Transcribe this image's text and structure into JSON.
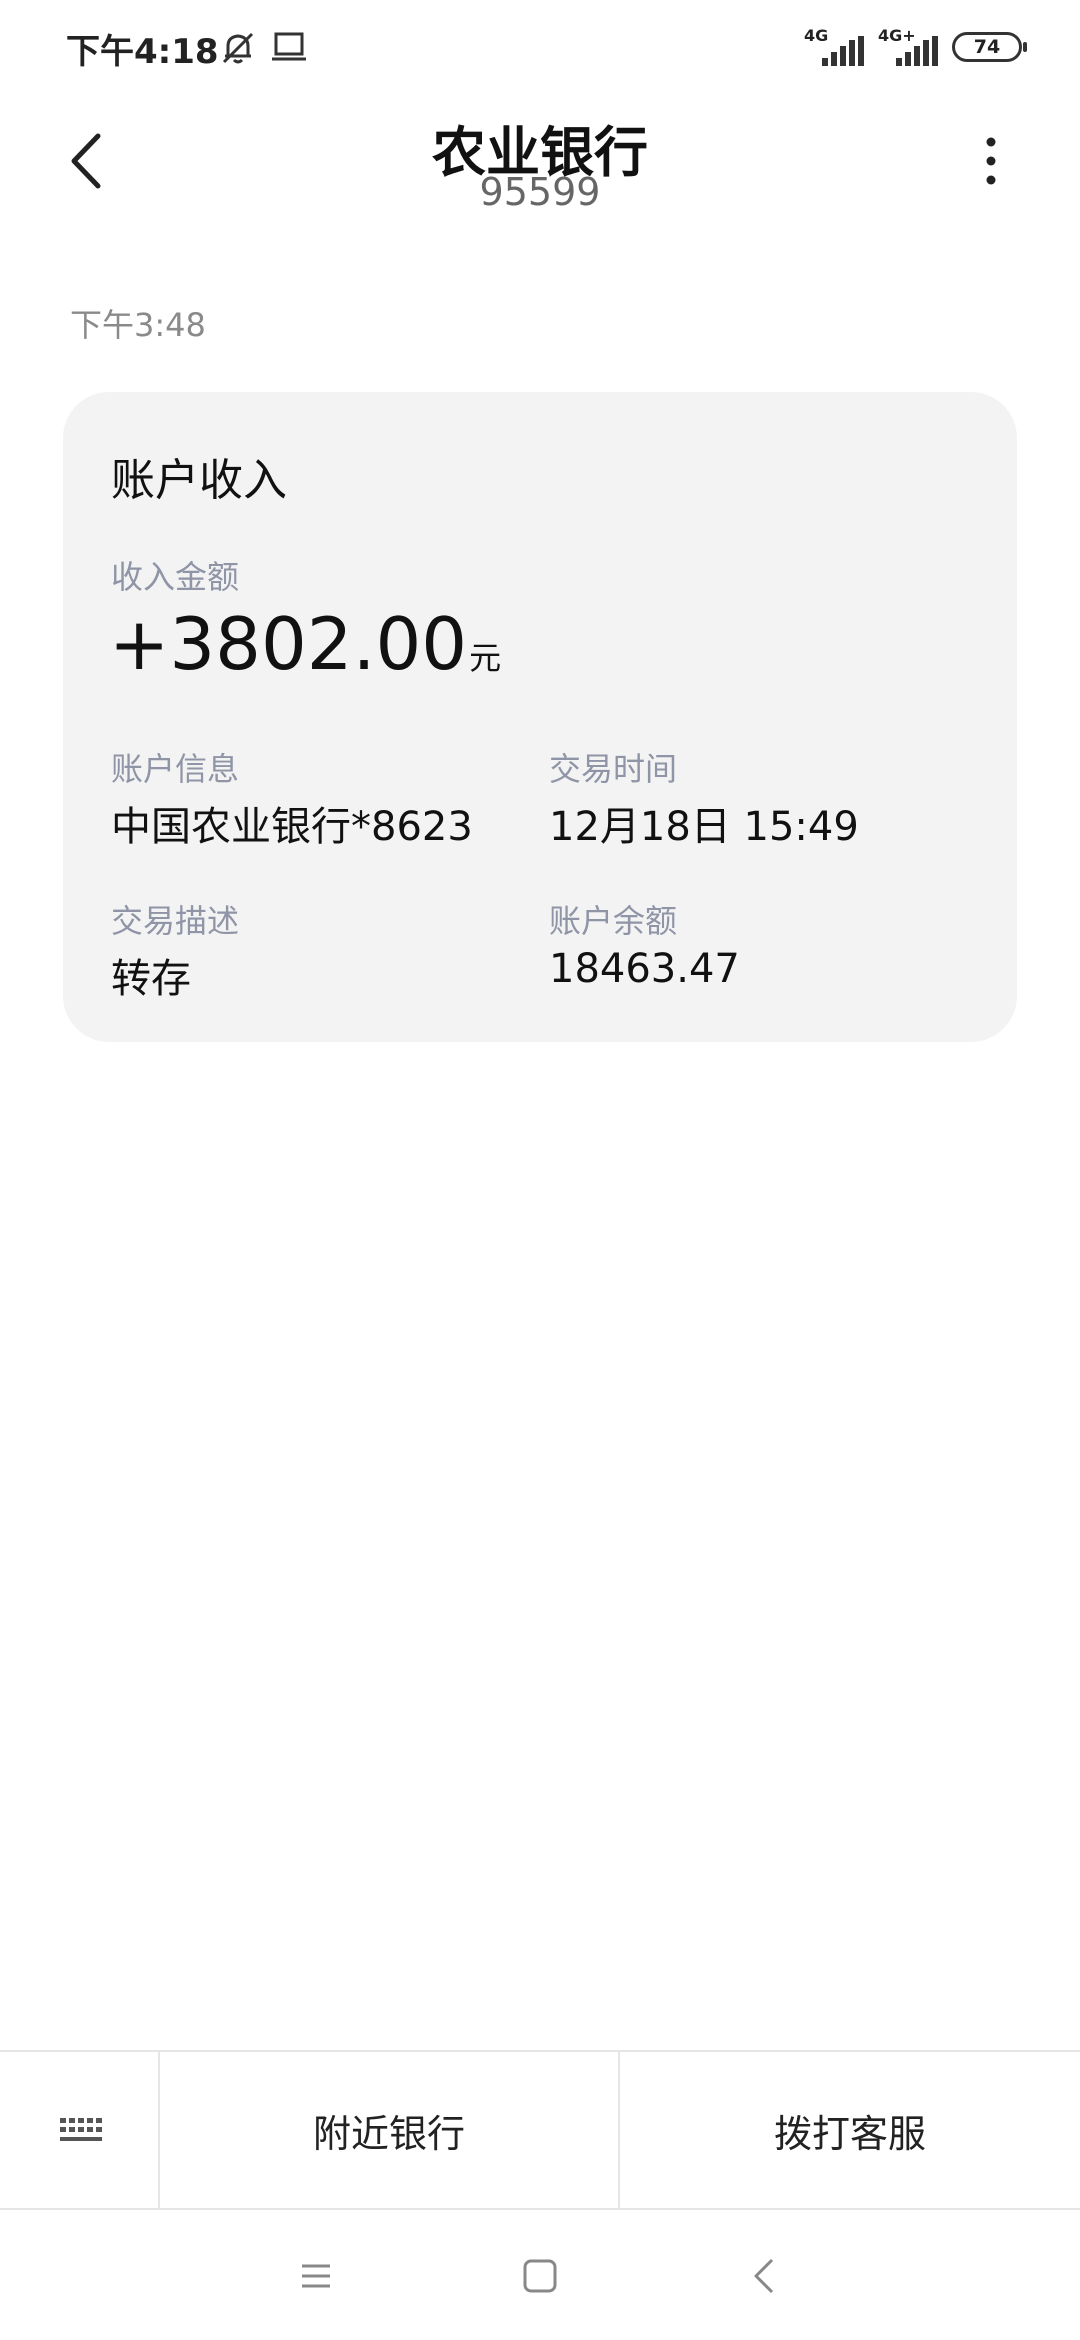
{
  "status_bar": {
    "time": "下午4:18",
    "signal_1_label": "4G",
    "signal_2_label": "4G+",
    "battery": "74"
  },
  "header": {
    "title": "农业银行",
    "subtitle": "95599"
  },
  "message": {
    "time": "下午3:48"
  },
  "card": {
    "title": "账户收入",
    "amount_label": "收入金额",
    "amount": "+3802.00",
    "amount_unit": "元",
    "account_info_label": "账户信息",
    "account_info_value": "中国农业银行*8623",
    "trade_time_label": "交易时间",
    "trade_time_value": "12月18日 15:49",
    "description_label": "交易描述",
    "description_value": "转存",
    "balance_label": "账户余额",
    "balance_value": "18463.47"
  },
  "menu": {
    "keyboard_icon": "keyboard-icon",
    "nearby_bank": "附近银行",
    "call_service": "拨打客服"
  },
  "icons": {
    "back": "chevron-left-icon",
    "more": "more-vertical-icon",
    "bell_muted": "bell-off-icon",
    "laptop": "laptop-icon",
    "nav_menu": "menu-icon",
    "nav_home": "square-icon",
    "nav_back": "triangle-back-icon"
  }
}
